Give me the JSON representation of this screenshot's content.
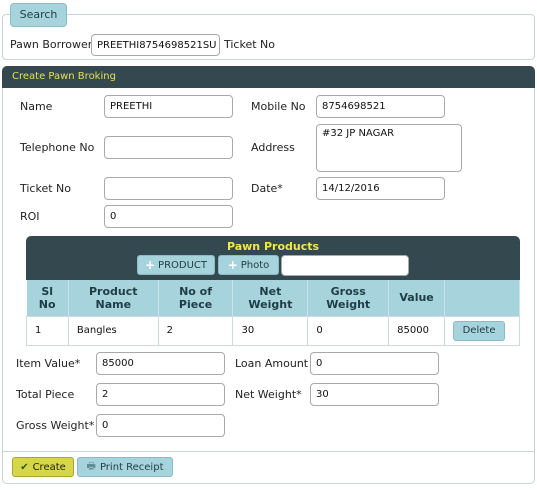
{
  "search": {
    "tab_label": "Search",
    "borrower_label": "Pawn Borrower",
    "borrower_value": "PREETHI8754698521SU",
    "ticket_label": "Ticket No"
  },
  "create_panel": {
    "title": "Create Pawn Broking",
    "name_label": "Name",
    "name_value": "PREETHI",
    "mobile_label": "Mobile No",
    "mobile_value": "8754698521",
    "telephone_label": "Telephone No",
    "telephone_value": "",
    "address_label": "Address",
    "address_value": "#32 JP NAGAR",
    "ticket_label": "Ticket No",
    "ticket_value": "",
    "date_label": "Date*",
    "date_value": "14/12/2016",
    "roi_label": "ROI",
    "roi_value": "0"
  },
  "products": {
    "title": "Pawn Products",
    "add_product_label": "PRODUCT",
    "add_photo_label": "Photo",
    "photo_input_value": "",
    "columns": [
      "Sl\nNo",
      "Product\nName",
      "No of\nPiece",
      "Net\nWeight",
      "Gross\nWeight",
      "Value",
      ""
    ],
    "rows": [
      {
        "sl": "1",
        "name": "Bangles",
        "pieces": "2",
        "net_weight": "30",
        "gross_weight": "0",
        "value": "85000",
        "action": "Delete"
      }
    ]
  },
  "summary": {
    "item_value_label": "Item Value*",
    "item_value": "85000",
    "loan_amount_label": "Loan Amount",
    "loan_amount": "0",
    "total_piece_label": "Total Piece",
    "total_piece": "2",
    "net_weight_label": "Net Weight*",
    "net_weight": "30",
    "gross_weight_label": "Gross Weight*",
    "gross_weight": "0"
  },
  "footer": {
    "create_label": "Create",
    "print_label": "Print Receipt"
  },
  "colors": {
    "header_bg": "#33484f",
    "header_text": "#e6e058",
    "button_bg": "#a7d3dc",
    "create_bg": "#d6d64a"
  }
}
